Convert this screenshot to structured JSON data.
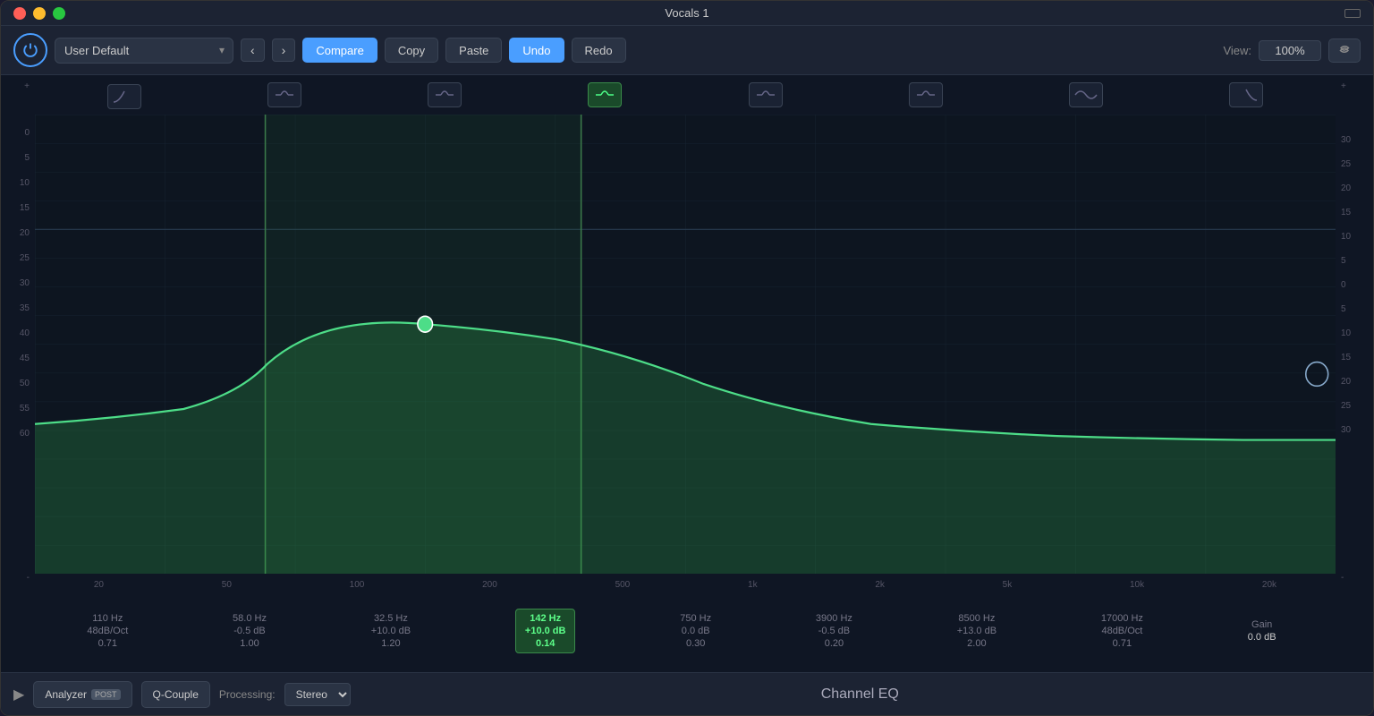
{
  "window": {
    "title": "Vocals 1"
  },
  "toolbar": {
    "preset": "User Default",
    "compare_label": "Compare",
    "copy_label": "Copy",
    "paste_label": "Paste",
    "undo_label": "Undo",
    "redo_label": "Redo",
    "view_label": "View:",
    "view_value": "100%",
    "nav_back": "‹",
    "nav_forward": "›"
  },
  "eq": {
    "freq_labels": [
      "20",
      "50",
      "100",
      "200",
      "500",
      "1k",
      "2k",
      "5k",
      "10k",
      "20k"
    ],
    "left_axis": [
      "+",
      "0",
      "5",
      "10",
      "15",
      "20",
      "25",
      "30",
      "35",
      "40",
      "45",
      "50",
      "55",
      "60",
      "-"
    ],
    "right_axis": [
      "+",
      "30",
      "25",
      "20",
      "15",
      "10",
      "5",
      "0",
      "5",
      "10",
      "15",
      "20",
      "25",
      "30",
      "-"
    ],
    "bands": [
      {
        "freq": "110 Hz",
        "param1": "48dB/Oct",
        "param2": "0.71",
        "type": "hp"
      },
      {
        "freq": "58.0 Hz",
        "param1": "-0.5 dB",
        "param2": "1.00",
        "type": "peak"
      },
      {
        "freq": "32.5 Hz",
        "param1": "+10.0 dB",
        "param2": "1.20",
        "type": "peak"
      },
      {
        "freq": "142 Hz",
        "param1": "+10.0 dB",
        "param2": "0.14",
        "type": "peak",
        "active": true
      },
      {
        "freq": "750 Hz",
        "param1": "0.0 dB",
        "param2": "0.30",
        "type": "peak"
      },
      {
        "freq": "3900 Hz",
        "param1": "-0.5 dB",
        "param2": "0.20",
        "type": "peak"
      },
      {
        "freq": "8500 Hz",
        "param1": "+13.0 dB",
        "param2": "2.00",
        "type": "peak"
      },
      {
        "freq": "17000 Hz",
        "param1": "48dB/Oct",
        "param2": "0.71",
        "type": "lp"
      }
    ],
    "gain": {
      "label": "Gain",
      "value": "0.0 dB"
    }
  },
  "bottom_bar": {
    "analyzer_label": "Analyzer",
    "post_label": "POST",
    "q_couple_label": "Q-Couple",
    "processing_label": "Processing:",
    "processing_value": "Stereo",
    "title": "Channel EQ"
  }
}
